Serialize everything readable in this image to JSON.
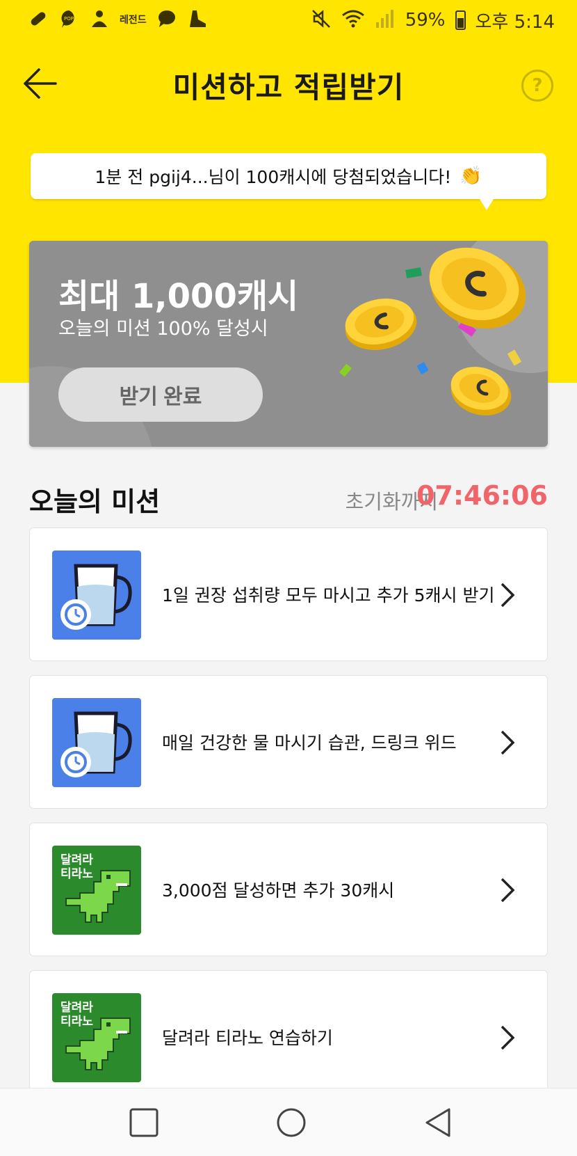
{
  "status_bar": {
    "left_icons": [
      "pill-icon",
      "pop-icon",
      "buddha-icon",
      "legend-icon",
      "chat-icon",
      "shoe-icon"
    ],
    "legend_label": "레전드",
    "pop_label": "POP",
    "battery": "59%",
    "time": "오후 5:14"
  },
  "header": {
    "title": "미션하고 적립받기",
    "help": "?"
  },
  "ticker": {
    "text": "1분 전 pgij4...님이 100캐시에 당첨되었습니다!",
    "emoji": "👏"
  },
  "reward": {
    "title": "최대 1,000캐시",
    "subtitle": "오늘의 미션 100% 달성시",
    "button": "받기 완료"
  },
  "missions_section": {
    "title": "오늘의 미션",
    "reset_label": "초기화까지",
    "reset_time": "07:46:06"
  },
  "missions": [
    {
      "text": "1일 권장 섭취량 모두 마시고 추가 5캐시 받기",
      "thumb": "water-cup"
    },
    {
      "text": "매일 건강한 물 마시기 습관, 드링크 위드",
      "thumb": "water-cup"
    },
    {
      "text": "3,000점 달성하면 추가 30캐시",
      "thumb": "dino",
      "thumb_label": [
        "달려라",
        "티라노"
      ]
    },
    {
      "text": "달려라 티라노 연습하기",
      "thumb": "dino",
      "thumb_label": [
        "달려라",
        "티라노"
      ]
    }
  ],
  "colors": {
    "brand_yellow": "#ffe500",
    "timer_red": "#f0646a",
    "card_gray": "#8f8f8f",
    "water_blue": "#4a80e8",
    "dino_green": "#2b8a2b"
  }
}
